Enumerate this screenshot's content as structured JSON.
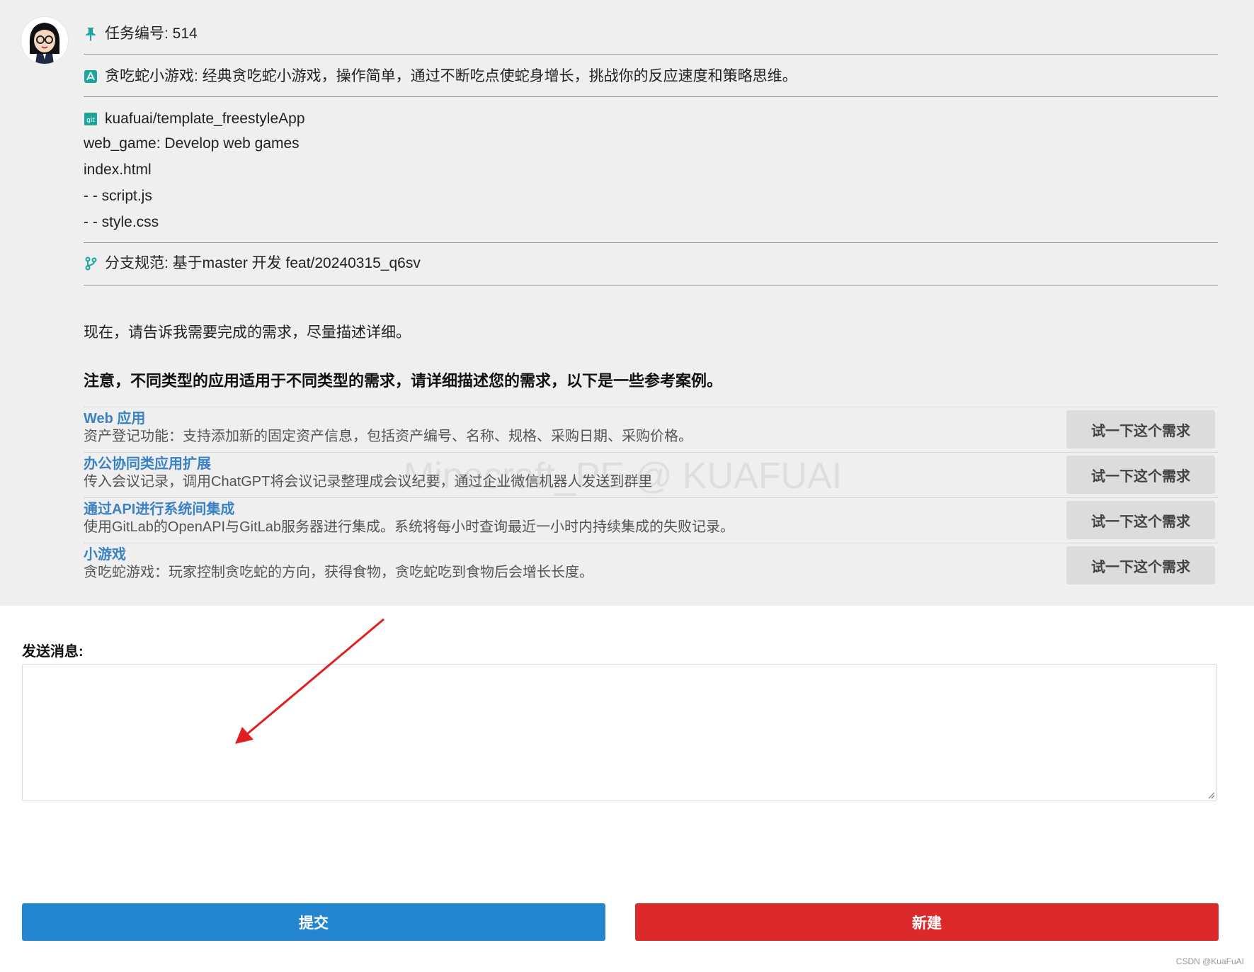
{
  "task": {
    "id_label": "任务编号: 514",
    "app_line": "贪吃蛇小游戏: 经典贪吃蛇小游戏，操作简单，通过不断吃点使蛇身增长，挑战你的反应速度和策略思维。",
    "repo": "kuafuai/template_freestyleApp",
    "repo_lines": [
      "web_game: Develop web games",
      "index.html",
      "- - script.js",
      "- - style.css"
    ],
    "branch_line": "分支规范: 基于master 开发 feat/20240315_q6sv"
  },
  "prompt_text": "现在，请告诉我需要完成的需求，尽量描述详细。",
  "note_text": "注意，不同类型的应用适用于不同类型的需求，请详细描述您的需求，以下是一些参考案例。",
  "examples": [
    {
      "title": "Web 应用",
      "desc": "资产登记功能：支持添加新的固定资产信息，包括资产编号、名称、规格、采购日期、采购价格。",
      "button": "试一下这个需求"
    },
    {
      "title": "办公协同类应用扩展",
      "desc": "传入会议记录，调用ChatGPT将会议记录整理成会议纪要，通过企业微信机器人发送到群里",
      "button": "试一下这个需求"
    },
    {
      "title": "通过API进行系统间集成",
      "desc": "使用GitLab的OpenAPI与GitLab服务器进行集成。系统将每小时查询最近一小时内持续集成的失败记录。",
      "button": "试一下这个需求"
    },
    {
      "title": "小游戏",
      "desc": "贪吃蛇游戏：玩家控制贪吃蛇的方向，获得食物，贪吃蛇吃到食物后会增长长度。",
      "button": "试一下这个需求"
    }
  ],
  "watermark": "Minecraft_PE @ KUAFUAI",
  "send": {
    "label": "发送消息:",
    "value": ""
  },
  "buttons": {
    "submit": "提交",
    "new": "新建"
  },
  "credit": "CSDN @KuaFuAI",
  "colors": {
    "accent_blue": "#2485d0",
    "danger_red": "#dc2a2a",
    "link_blue": "#3b82c4",
    "icon_teal": "#1aa69a",
    "panel_bg": "#efefef"
  }
}
